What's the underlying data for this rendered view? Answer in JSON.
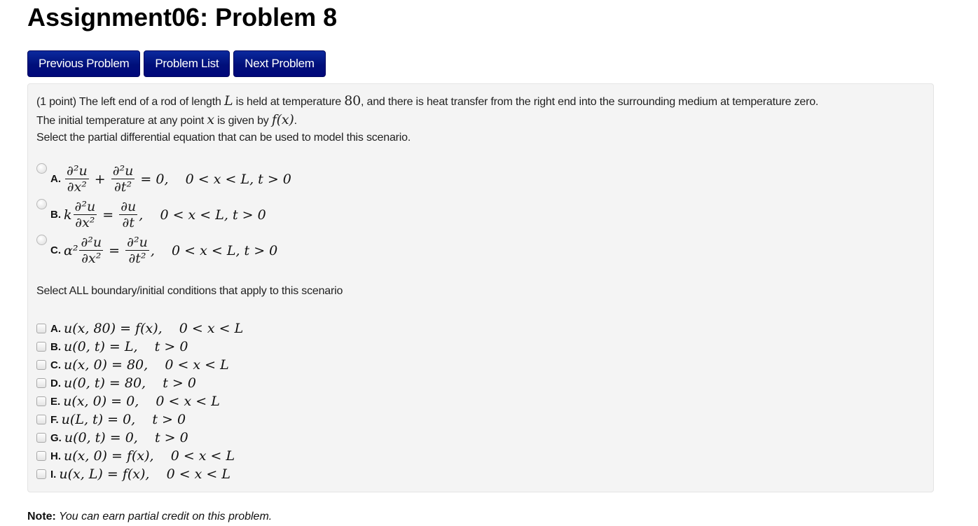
{
  "page": {
    "title": "Assignment06: Problem 8"
  },
  "nav": {
    "previous": "Previous Problem",
    "list": "Problem List",
    "next": "Next Problem"
  },
  "problem": {
    "points": "(1 point)",
    "line1_a": " The left end of a rod of length ",
    "line1_var_L": "L",
    "line1_b": " is held at temperature ",
    "line1_temp": "80",
    "line1_c": ", and there is heat transfer from the right end into the surrounding medium at temperature zero.",
    "line2_a": "The initial temperature at any point ",
    "line2_var_x": "x",
    "line2_b": " is given by ",
    "line2_f": "f(x)",
    "line2_c": ".",
    "line3": "Select the partial differential equation that can be used to model this scenario.",
    "pde_options": [
      {
        "letter": "A.",
        "prefix": "",
        "frac1_num": "∂²u",
        "frac1_den": "∂x²",
        "op": " + ",
        "frac2_num": "∂²u",
        "frac2_den": "∂t²",
        "rest": " = 0,    0 < x < L, t > 0",
        "selected": false
      },
      {
        "letter": "B.",
        "prefix": "k",
        "frac1_num": "∂²u",
        "frac1_den": "∂x²",
        "op": " = ",
        "frac2_num": "∂u",
        "frac2_den": "∂t",
        "rest": ",    0 < x < L, t > 0",
        "selected": false
      },
      {
        "letter": "C.",
        "prefix": "α²",
        "frac1_num": "∂²u",
        "frac1_den": "∂x²",
        "op": " = ",
        "frac2_num": "∂²u",
        "frac2_den": "∂t²",
        "rest": ",    0 < x < L, t > 0",
        "selected": false
      }
    ],
    "bc_label": "Select ALL boundary/initial conditions that apply to this scenario",
    "bc_options": [
      {
        "letter": "A.",
        "expr": "u(x, 80) = f(x),    0 < x < L",
        "checked": false
      },
      {
        "letter": "B.",
        "expr": "u(0, t) = L,    t > 0",
        "checked": false
      },
      {
        "letter": "C.",
        "expr": "u(x, 0) = 80,    0 < x < L",
        "checked": false
      },
      {
        "letter": "D.",
        "expr": "u(0, t) = 80,    t > 0",
        "checked": false
      },
      {
        "letter": "E.",
        "expr": "u(x, 0) = 0,    0 < x < L",
        "checked": false
      },
      {
        "letter": "F.",
        "expr": "u(L, t) = 0,    t > 0",
        "checked": false
      },
      {
        "letter": "G.",
        "expr": "u(0, t) = 0,    t > 0",
        "checked": false
      },
      {
        "letter": "H.",
        "expr": "u(x, 0) = f(x),    0 < x < L",
        "checked": false
      },
      {
        "letter": "I.",
        "expr": "u(x, L) = f(x),    0 < x < L",
        "checked": false
      }
    ]
  },
  "note": {
    "label": "Note:",
    "text": " You can earn partial credit on this problem."
  },
  "colors": {
    "button_bg": "#000f7a",
    "panel_bg": "#f4f4f4"
  }
}
